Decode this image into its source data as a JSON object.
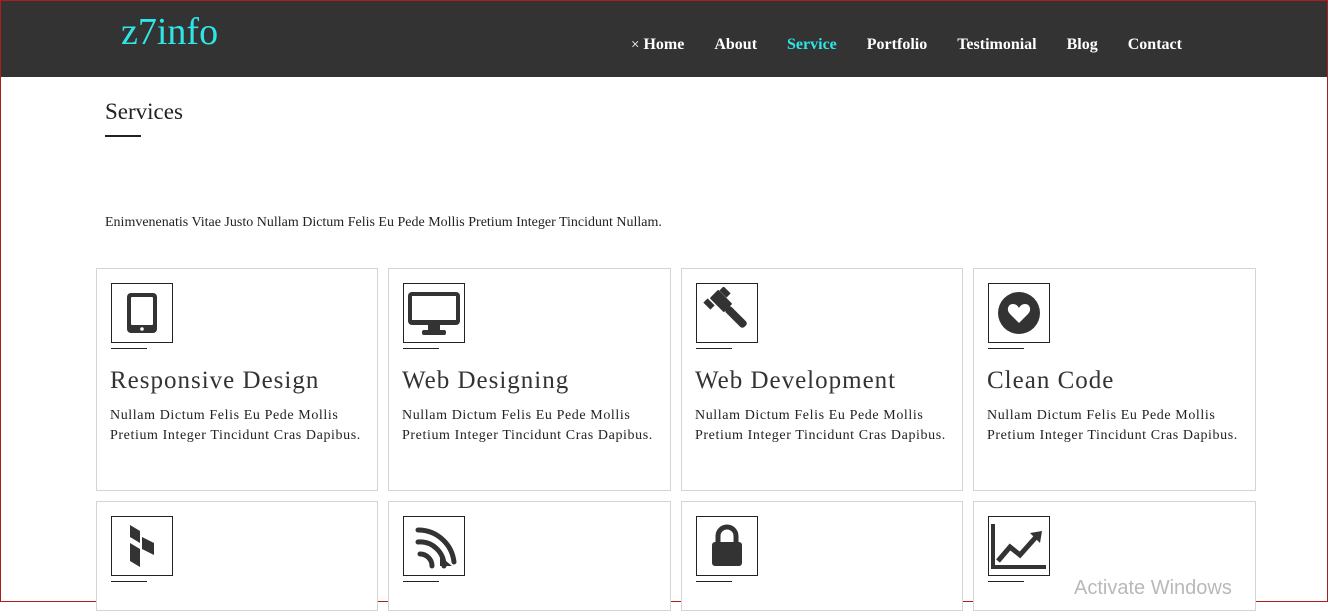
{
  "header": {
    "brand": "z7info",
    "nav": [
      {
        "label": "Home",
        "prefix": "×",
        "active": false
      },
      {
        "label": "About",
        "active": false
      },
      {
        "label": "Service",
        "active": true
      },
      {
        "label": "Portfolio",
        "active": false
      },
      {
        "label": "Testimonial",
        "active": false
      },
      {
        "label": "Blog",
        "active": false
      },
      {
        "label": "Contact",
        "active": false
      }
    ]
  },
  "services": {
    "title": "Services",
    "intro": "Enimvenenatis Vitae Justo Nullam Dictum Felis Eu Pede Mollis Pretium Integer Tincidunt Nullam.",
    "cards": [
      {
        "icon": "tablet-icon",
        "title": "Responsive Design",
        "description": "Nullam Dictum Felis Eu Pede Mollis Pretium Integer Tincidunt Cras Dapibus."
      },
      {
        "icon": "desktop-icon",
        "title": "Web Designing",
        "description": "Nullam Dictum Felis Eu Pede Mollis Pretium Integer Tincidunt Cras Dapibus."
      },
      {
        "icon": "gavel-icon",
        "title": "Web Development",
        "description": "Nullam Dictum Felis Eu Pede Mollis Pretium Integer Tincidunt Cras Dapibus."
      },
      {
        "icon": "heart-icon",
        "title": "Clean Code",
        "description": "Nullam Dictum Felis Eu Pede Mollis Pretium Integer Tincidunt Cras Dapibus."
      },
      {
        "icon": "houzz-icon",
        "title": "",
        "description": ""
      },
      {
        "icon": "signal-feed-icon",
        "title": "",
        "description": ""
      },
      {
        "icon": "lock-icon",
        "title": "",
        "description": ""
      },
      {
        "icon": "line-chart-icon",
        "title": "",
        "description": ""
      }
    ]
  },
  "watermark": "Activate Windows",
  "colors": {
    "navbar": "#333333",
    "accent": "#2ee6e6",
    "border": "#d4d4d4"
  }
}
